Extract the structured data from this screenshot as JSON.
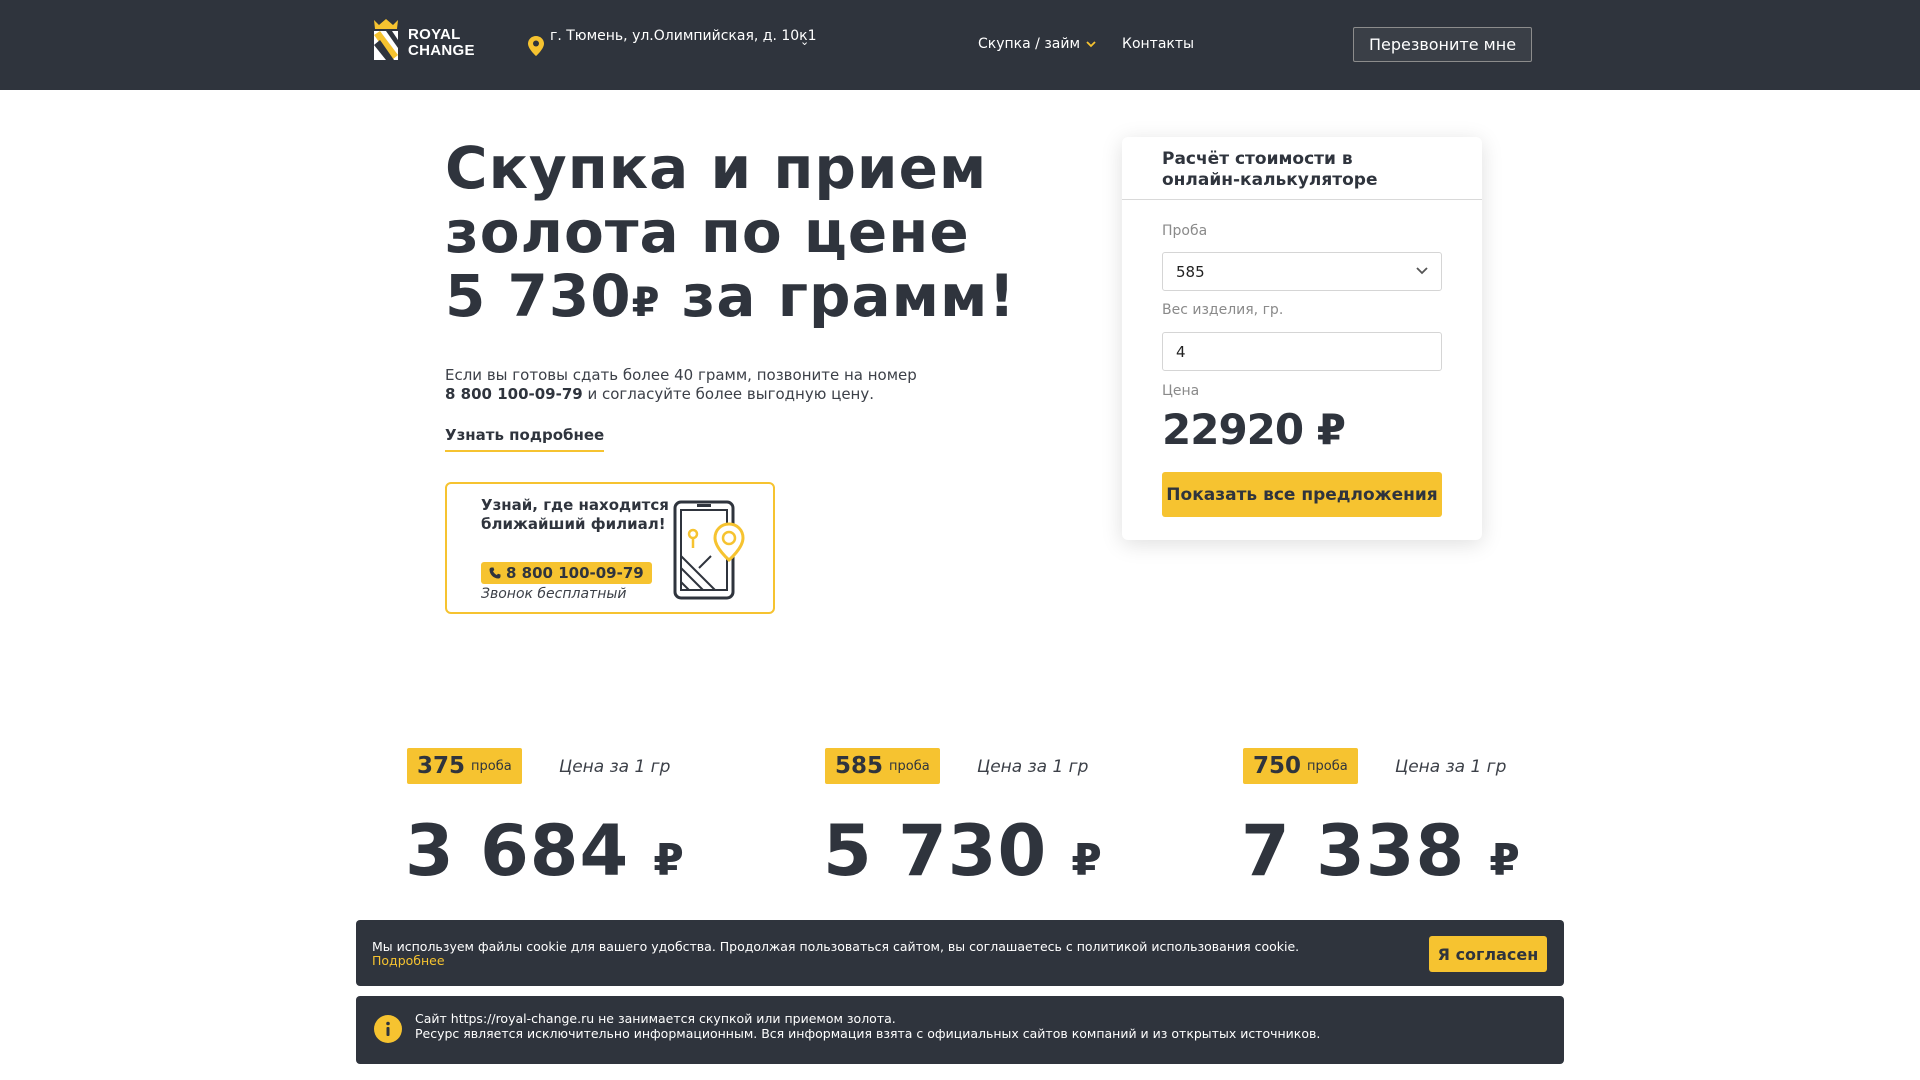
{
  "header": {
    "logo_line1": "ROYAL",
    "logo_line2": "CHANGE",
    "address": "г. Тюмень, ул.Олимпийская, д. 10к1",
    "nav": [
      {
        "label": "Скупка / займ",
        "has_dropdown": true
      },
      {
        "label": "Контакты",
        "has_dropdown": false
      }
    ],
    "callback_label": "Перезвоните мне"
  },
  "hero": {
    "title_line1": "Скупка и прием",
    "title_line2": "золота по цене",
    "title_price": "5 730",
    "title_currency": "₽",
    "title_suffix": " за грамм!",
    "desc_line1": "Если вы готовы сдать более 40 грамм, позвоните на номер",
    "desc_phone": "8 800 100-09-79",
    "desc_line2": " и согласуйте более выгодную цену.",
    "more_link": "Узнать подробнее"
  },
  "branch": {
    "title": "Узнай, где находится ближайший филиал!",
    "phone": "8 800 100-09-79",
    "note": "Звонок бесплатный"
  },
  "calculator": {
    "heading": "Расчёт стоимости в онлайн-калькуляторе",
    "proba_label": "Проба",
    "proba_value": "585",
    "weight_label": "Вес изделия, гр.",
    "weight_value": "4",
    "price_label": "Цена",
    "price_value": "22920 ₽",
    "button_label": "Показать все предложения"
  },
  "prices": [
    {
      "proba": "375",
      "proba_label": "проба",
      "per_label": "Цена за 1 гр",
      "value": "3 684",
      "currency": "₽"
    },
    {
      "proba": "585",
      "proba_label": "проба",
      "per_label": "Цена за 1 гр",
      "value": "5 730",
      "currency": "₽"
    },
    {
      "proba": "750",
      "proba_label": "проба",
      "per_label": "Цена за 1 гр",
      "value": "7 338",
      "currency": "₽"
    }
  ],
  "cookie": {
    "text": "Мы используем файлы cookie для вашего удобства. Продолжая пользоваться сайтом, вы соглашаетесь с политикой использования cookie.",
    "more": "Подробнее",
    "accept": "Я согласен"
  },
  "notice": {
    "line1": "Сайт https://royal-change.ru не занимается скупкой или приемом золота.",
    "line2": "Ресурс является исключительно информационным. Вся информация взята с официальных сайтов компаний и из открытых источников."
  },
  "colors": {
    "dark": "#2f343d",
    "accent": "#f6c330"
  }
}
